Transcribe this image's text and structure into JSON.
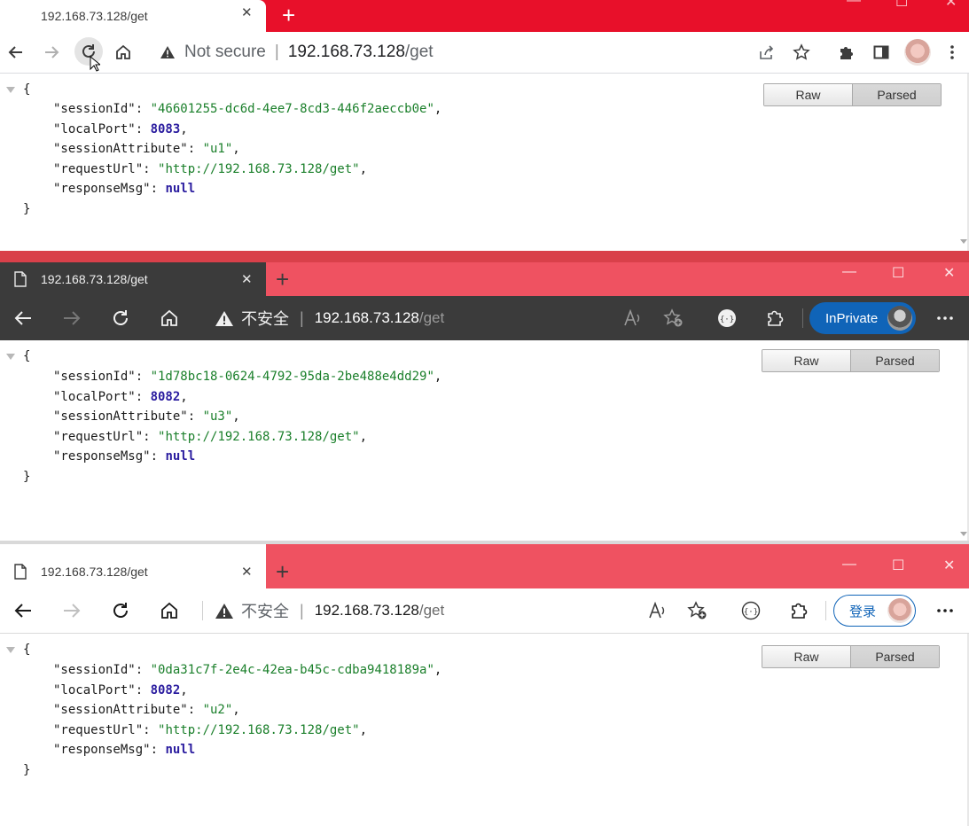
{
  "windows": [
    {
      "tab_title": "192.168.73.128/get",
      "security_label": "Not secure",
      "url_host": "192.168.73.128",
      "url_path": "/get",
      "json": {
        "sessionId": "\"46601255-dc6d-4ee7-8cd3-446f2aeccb0e\"",
        "localPort": "8083",
        "sessionAttribute": "\"u1\"",
        "requestUrl": "\"http://192.168.73.128/get\"",
        "responseMsg": "null"
      }
    },
    {
      "tab_title": "192.168.73.128/get",
      "security_label": "不安全",
      "url_host": "192.168.73.128",
      "url_path": "/get",
      "profile_label": "InPrivate",
      "json": {
        "sessionId": "\"1d78bc18-0624-4792-95da-2be488e4dd29\"",
        "localPort": "8082",
        "sessionAttribute": "\"u3\"",
        "requestUrl": "\"http://192.168.73.128/get\"",
        "responseMsg": "null"
      }
    },
    {
      "tab_title": "192.168.73.128/get",
      "security_label": "不安全",
      "url_host": "192.168.73.128",
      "url_path": "/get",
      "profile_label": "登录",
      "json": {
        "sessionId": "\"0da31c7f-2e4c-42ea-b45c-cdba9418189a\"",
        "localPort": "8082",
        "sessionAttribute": "\"u2\"",
        "requestUrl": "\"http://192.168.73.128/get\"",
        "responseMsg": "null"
      }
    }
  ],
  "json_keys": {
    "sessionId": "\"sessionId\"",
    "localPort": "\"localPort\"",
    "sessionAttribute": "\"sessionAttribute\"",
    "requestUrl": "\"requestUrl\"",
    "responseMsg": "\"responseMsg\""
  },
  "punct": {
    "open": "{",
    "close": "}",
    "colon": ": ",
    "comma": ",",
    "url_sep": "|"
  },
  "viewer": {
    "raw_label": "Raw",
    "parsed_label": "Parsed",
    "active": "Parsed"
  },
  "icons": {
    "back": "back-arrow-icon",
    "forward": "forward-arrow-icon",
    "reload": "reload-icon",
    "home": "home-icon",
    "warning": "warning-icon",
    "share": "share-icon",
    "star": "star-icon",
    "extensions": "puzzle-icon",
    "sidepanel": "side-panel-icon",
    "more": "more-dots-icon",
    "read_aloud": "read-aloud-icon",
    "add_favorite": "add-favorite-icon",
    "json_tool": "json-braces-icon",
    "page": "page-icon"
  },
  "colors": {
    "chrome_frame": "#e8102a",
    "edge_frame": "#ef5261",
    "edge_dark_toolbar": "#3b3b3b",
    "inprivate_blue": "#1064b8",
    "json_string": "#1a7f2a",
    "json_number": "#2a1c9f"
  }
}
